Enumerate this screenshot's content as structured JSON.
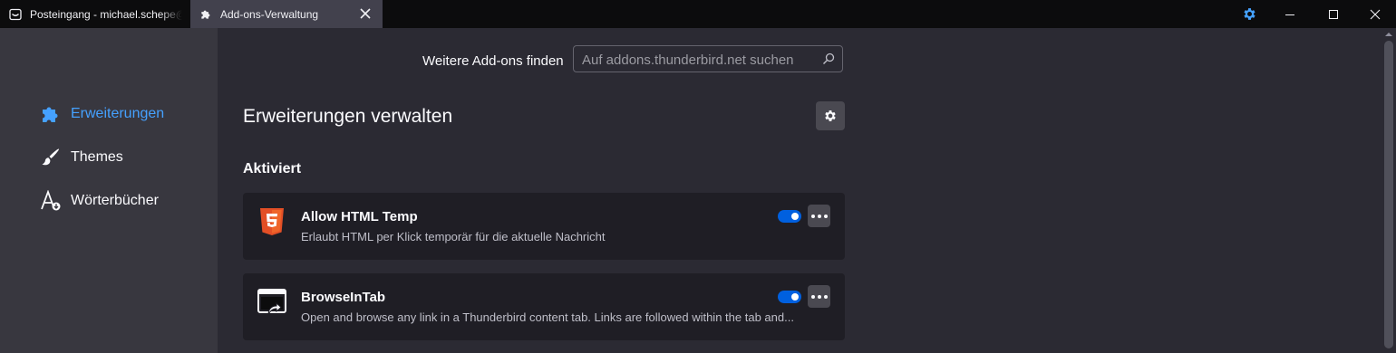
{
  "tabs": [
    {
      "label": "Posteingang - michael.schepe@",
      "icon": "inbox-icon",
      "active": false
    },
    {
      "label": "Add-ons-Verwaltung",
      "icon": "puzzle-icon",
      "active": true
    }
  ],
  "window_controls": {
    "settings_icon": "gear-icon",
    "minimize": "minimize-icon",
    "maximize": "maximize-icon",
    "close": "close-icon"
  },
  "sidebar": {
    "items": [
      {
        "label": "Erweiterungen",
        "icon": "puzzle-icon",
        "selected": true
      },
      {
        "label": "Themes",
        "icon": "brush-icon",
        "selected": false
      },
      {
        "label": "Wörterbücher",
        "icon": "dictionary-icon",
        "selected": false
      }
    ]
  },
  "search": {
    "label": "Weitere Add-ons finden",
    "placeholder": "Auf addons.thunderbird.net suchen",
    "value": ""
  },
  "main": {
    "heading": "Erweiterungen verwalten",
    "section": "Aktiviert"
  },
  "addons": [
    {
      "name": "Allow HTML Temp",
      "description": "Erlaubt HTML per Klick temporär für die aktuelle Nachricht",
      "icon": "html5-icon",
      "enabled": true
    },
    {
      "name": "BrowseInTab",
      "description": "Open and browse any link in a Thunderbird content tab. Links are followed within the tab and...",
      "icon": "browse-in-tab-icon",
      "enabled": true
    }
  ],
  "colors": {
    "accent": "#45a1ff",
    "toggle_on": "#0060df",
    "background": "#2b2a33",
    "sidebar": "#38373f",
    "card": "#1f1e25"
  }
}
